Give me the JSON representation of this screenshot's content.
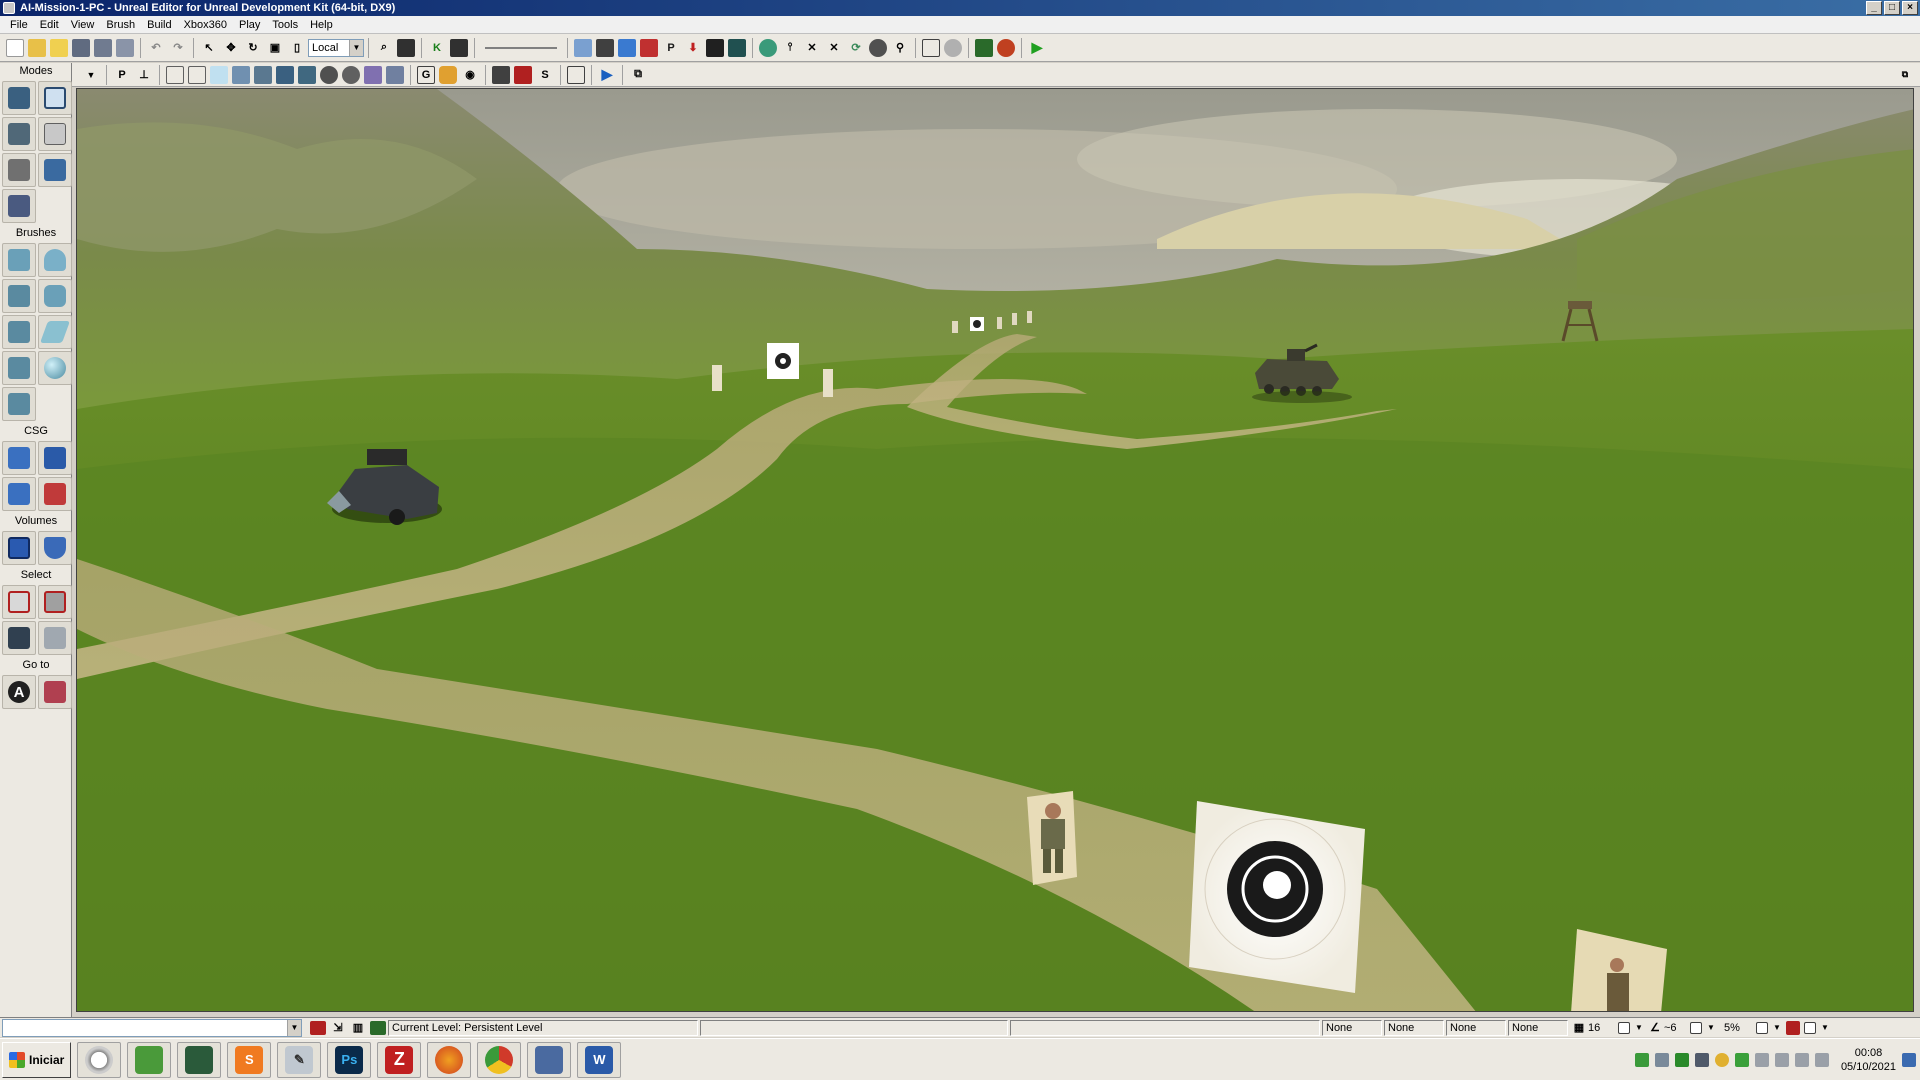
{
  "window": {
    "title": "AI-Mission-1-PC - Unreal Editor for Unreal Development Kit (64-bit, DX9)",
    "controls": {
      "minimize": "_",
      "maximize": "□",
      "close": "×"
    }
  },
  "menu": [
    "File",
    "Edit",
    "View",
    "Brush",
    "Build",
    "Xbox360",
    "Play",
    "Tools",
    "Help"
  ],
  "toolbar": {
    "coordinate_system": "Local"
  },
  "modes_panel": {
    "modes_label": "Modes",
    "brushes_label": "Brushes",
    "csg_label": "CSG",
    "volumes_label": "Volumes",
    "select_label": "Select",
    "goto_label": "Go to",
    "goto_letter": "A"
  },
  "viewport_toolbar": {
    "p_label": "P",
    "g_label": "G",
    "s_label": "S"
  },
  "statusbar": {
    "current_level_label": "Current Level:",
    "current_level_value": "Persistent Level",
    "slots": [
      "None",
      "None",
      "None",
      "None"
    ],
    "grid_size": "16",
    "rotation_snap": "~6",
    "scale_snap": "5%"
  },
  "taskbar": {
    "start_label": "Iniciar",
    "apps": [
      "clock-app",
      "chart-app",
      "monitor-app",
      "sublime",
      "tool-app",
      "Ps",
      "filezilla",
      "firefox",
      "chrome",
      "outlook",
      "W"
    ],
    "clock_time": "00:08",
    "clock_date": "05/10/2021"
  }
}
